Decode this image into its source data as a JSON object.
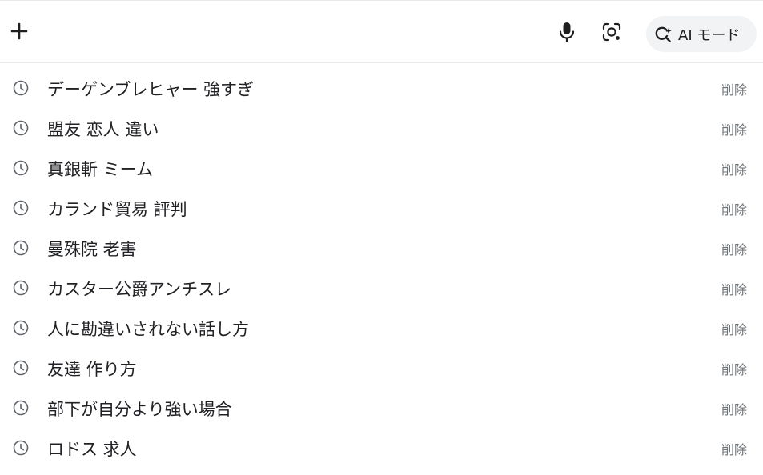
{
  "search": {
    "value": "",
    "placeholder": "",
    "plus_icon": "plus-icon",
    "mic_icon": "microphone-icon",
    "lens_icon": "camera-lens-icon",
    "ai_mode_icon": "search-sparkle-icon",
    "ai_mode_label": "AI モード"
  },
  "history": {
    "items": [
      {
        "text": "デーゲンブレヒャー 強すぎ",
        "delete_label": "削除"
      },
      {
        "text": "盟友 恋人 違い",
        "delete_label": "削除"
      },
      {
        "text": "真銀斬 ミーム",
        "delete_label": "削除"
      },
      {
        "text": "カランド貿易 評判",
        "delete_label": "削除"
      },
      {
        "text": "曼殊院 老害",
        "delete_label": "削除"
      },
      {
        "text": "カスター公爵アンチスレ",
        "delete_label": "削除"
      },
      {
        "text": "人に勘違いされない話し方",
        "delete_label": "削除"
      },
      {
        "text": "友達 作り方",
        "delete_label": "削除"
      },
      {
        "text": "部下が自分より強い場合",
        "delete_label": "削除"
      },
      {
        "text": "ロドス 求人",
        "delete_label": "削除"
      }
    ]
  },
  "colors": {
    "text": "#202124",
    "secondary": "#70757a",
    "icon": "#5f6368",
    "ai_button_bg": "#f1f3f4",
    "divider": "#e8eaed"
  }
}
